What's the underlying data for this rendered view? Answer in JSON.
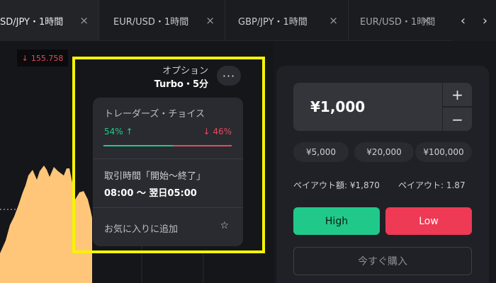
{
  "tabs": [
    {
      "label": "SD/JPY・1時間",
      "close": "×"
    },
    {
      "label": "EUR/USD・1時間",
      "close": "×"
    },
    {
      "label": "GBP/JPY・1時間",
      "close": "×"
    },
    {
      "label": "EUR/USD・1時間",
      "close": "×"
    }
  ],
  "tab_nav": {
    "prev": "‹",
    "next": "›"
  },
  "chart": {
    "price_tag": {
      "arrow": "↓",
      "value": "155.758"
    }
  },
  "option": {
    "title": "オプション",
    "subtitle": "Turbo・5分",
    "more": "···"
  },
  "popup": {
    "sentiment_title": "トレーダーズ・チョイス",
    "up_pct": "54%",
    "up_arrow": "↑",
    "down_pct": "46%",
    "down_arrow": "↓",
    "up_ratio": 0.54,
    "time_label": "取引時間「開始～終了」",
    "time_value": "08:00 〜 翌日05:00",
    "favorite_label": "お気に入りに追加",
    "favorite_icon": "☆"
  },
  "trade": {
    "amount": "¥1,000",
    "plus": "+",
    "minus": "−",
    "presets": [
      "¥5,000",
      "¥20,000",
      "¥100,000"
    ],
    "payout_amount": "ペイアウト額: ¥1,870",
    "payout_rate": "ペイアウト: 1.87",
    "high_label": "High",
    "low_label": "Low",
    "buy_label": "今すぐ購入"
  },
  "colors": {
    "highlight": "#f5f500",
    "up": "#22c98a",
    "down": "#e24b5e",
    "chart_fill": "#ffc67a"
  }
}
